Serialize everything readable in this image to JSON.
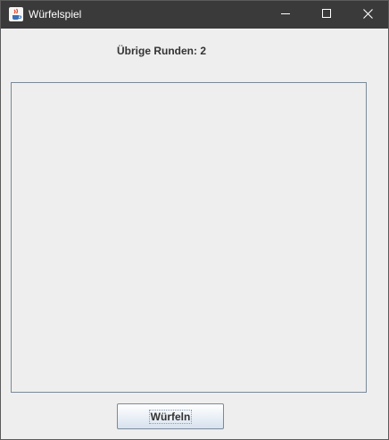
{
  "window": {
    "title": "Würfelspiel",
    "icons": {
      "app": "java-coffee-cup-icon",
      "minimize": "minimize-icon",
      "maximize": "maximize-icon",
      "close": "close-icon"
    }
  },
  "status": {
    "rounds_text": "Übrige Runden: 2"
  },
  "actions": {
    "roll_label": "Würfeln"
  },
  "colors": {
    "titlebar": "#3a3a3a",
    "window_bg": "#eeeeee",
    "panel_border": "#7a8a99",
    "text": "#333333"
  }
}
